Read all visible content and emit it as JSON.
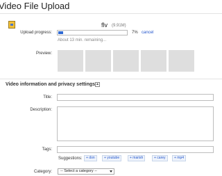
{
  "window": {
    "title": "Video File Upload"
  },
  "file": {
    "name": "flv",
    "size": "(9.91M)",
    "icon": "file-icon"
  },
  "upload": {
    "progress_label": "Upload progress:",
    "progress": 0.07,
    "percent_text": "7%",
    "cancel_label": "cancel",
    "remaining": "About 13 min. remaining..."
  },
  "preview": {
    "label": "Preview:",
    "thumbnail_count": 5
  },
  "section": {
    "title": "Video information and privacy settings",
    "toggle_icon": "collapse-icon"
  },
  "form": {
    "title_label": "Title:",
    "title_value": "",
    "description_label": "Description:",
    "description_value": "",
    "tags_label": "Tags:",
    "tags_value": "",
    "suggestions_label": "Suggestions:",
    "suggestions": [
      "+ don",
      "+ youtube",
      "+ marish",
      "+ carey",
      "+ mp4"
    ],
    "category_label": "Category:",
    "category_selected": "-- Select a category --"
  },
  "colors": {
    "progress": "#2f6ad4",
    "link": "#2255cc",
    "thumb": "#dedede"
  }
}
